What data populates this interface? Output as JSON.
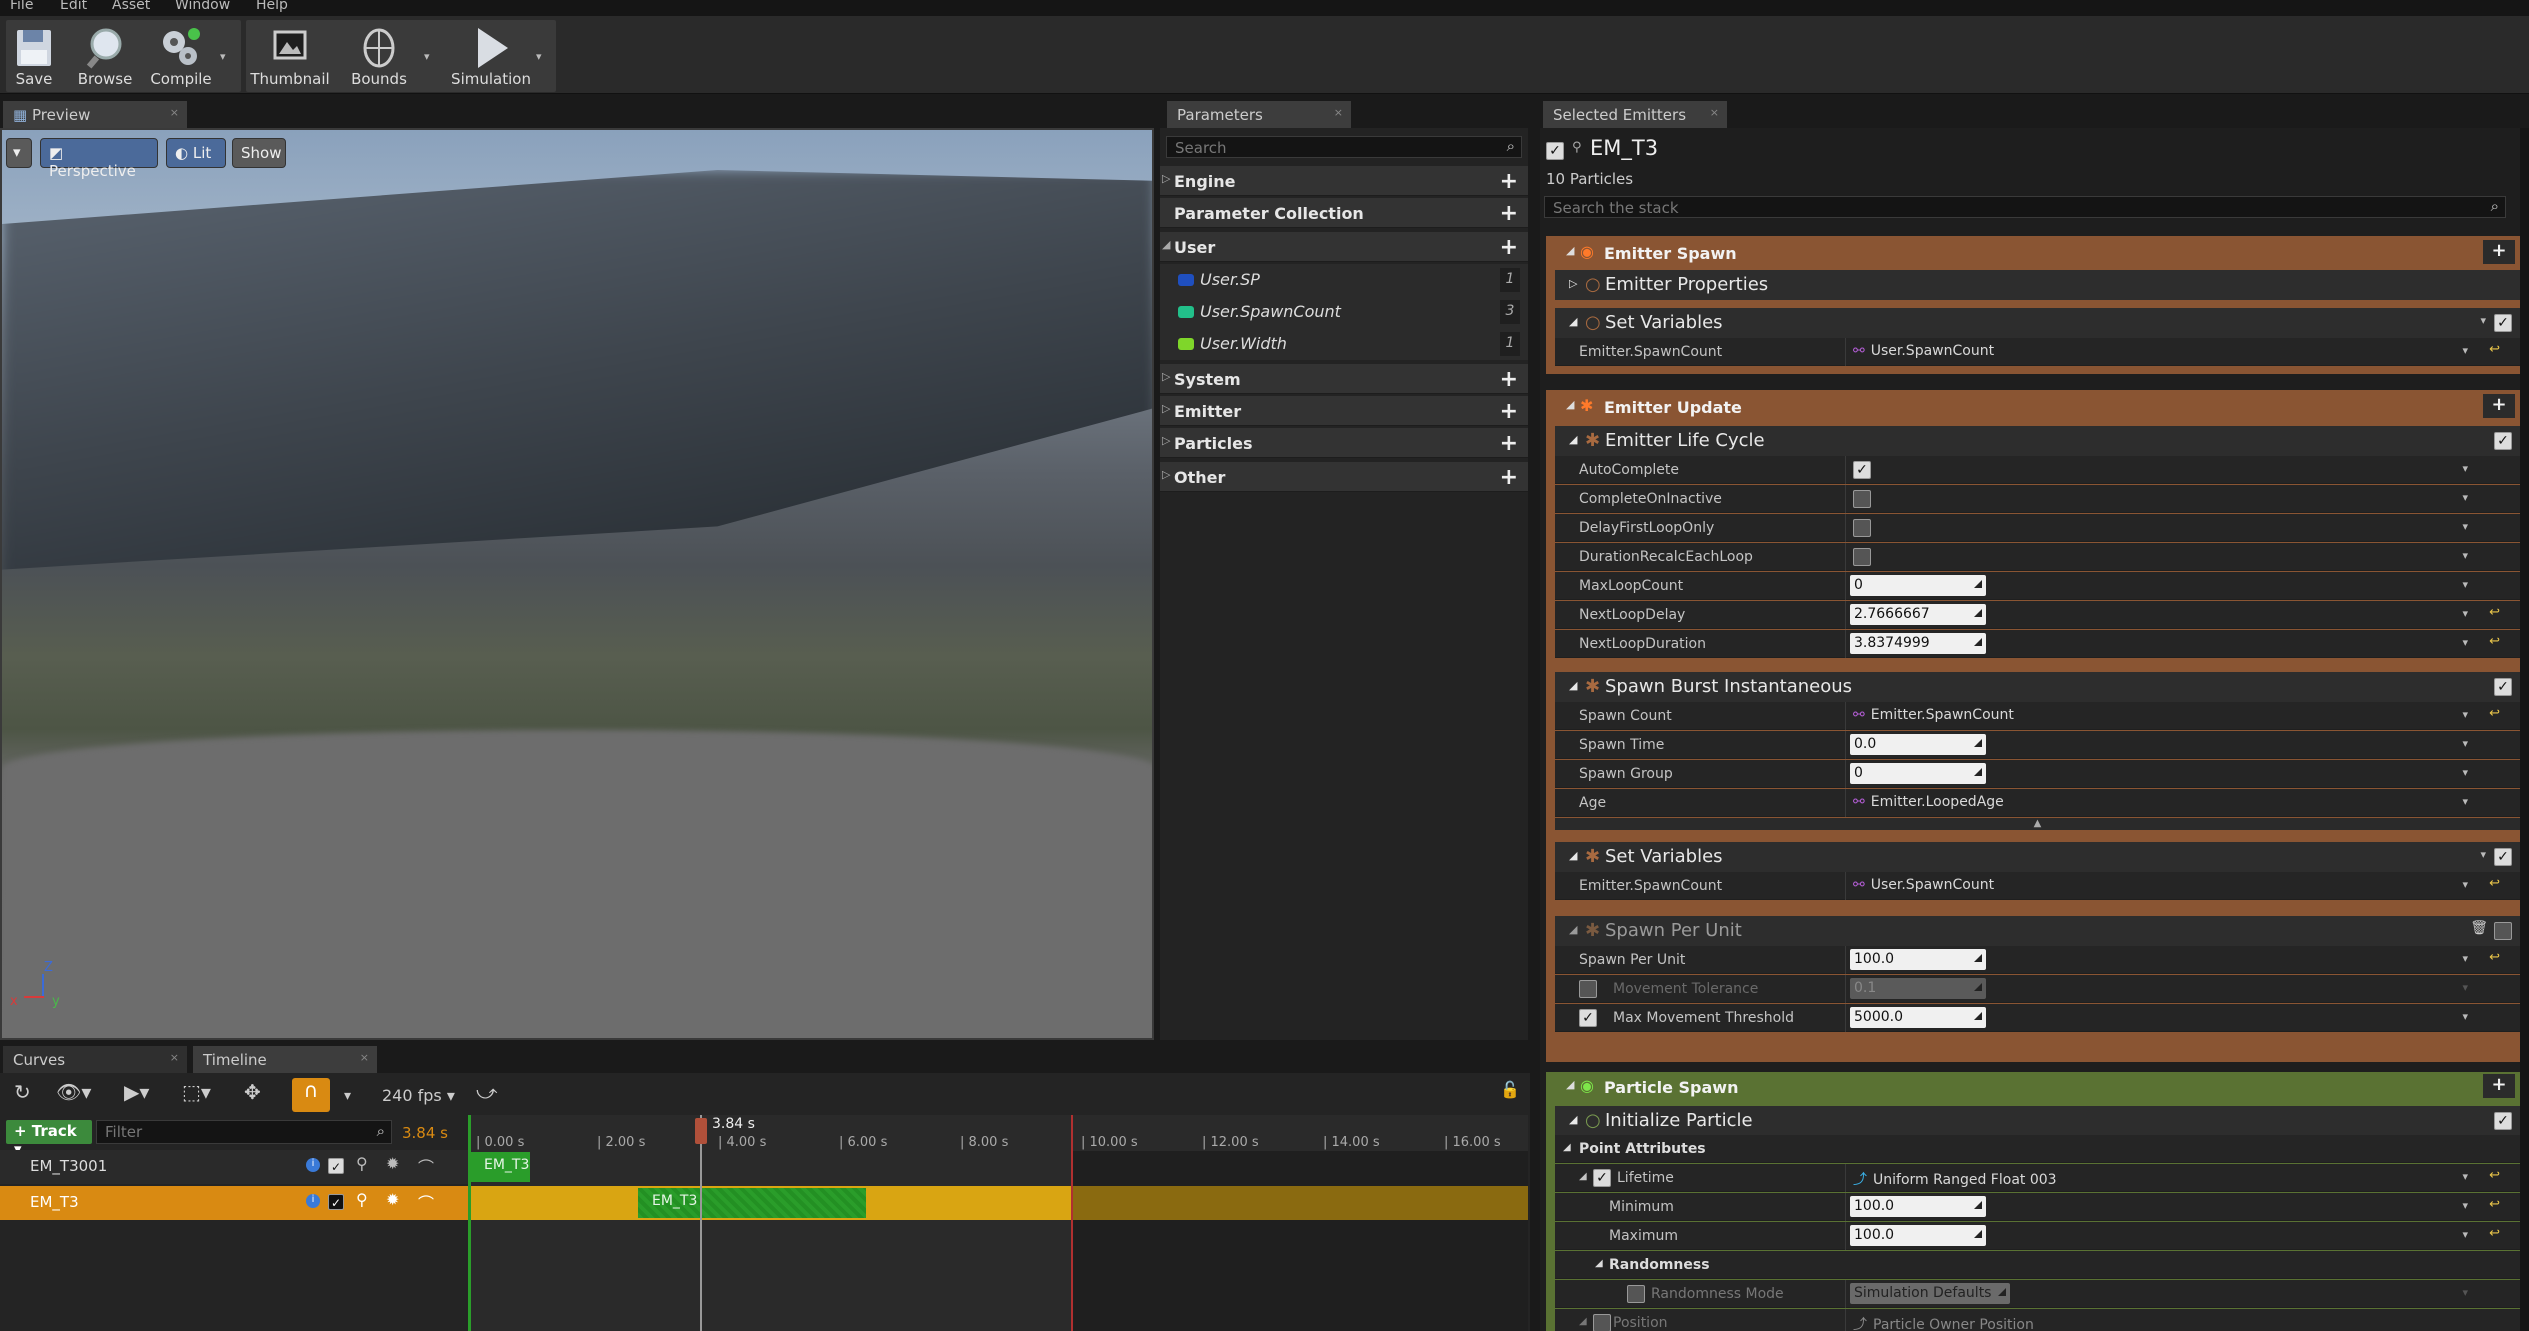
{
  "menu": [
    "File",
    "Edit",
    "Asset",
    "Window",
    "Help"
  ],
  "toolbar": {
    "save": "Save",
    "browse": "Browse",
    "compile": "Compile",
    "thumbnail": "Thumbnail",
    "bounds": "Bounds",
    "simulation": "Simulation"
  },
  "preview": {
    "tab": "Preview",
    "perspective": "Perspective",
    "lit": "Lit",
    "show": "Show"
  },
  "parameters": {
    "tab": "Parameters",
    "search_placeholder": "Search",
    "categories": {
      "engine": "Engine",
      "collection": "Parameter Collection",
      "user": "User",
      "system": "System",
      "emitter": "Emitter",
      "particles": "Particles",
      "other": "Other"
    },
    "user_items": [
      {
        "name": "User.SP",
        "value": "1",
        "color": "#1f4fbf"
      },
      {
        "name": "User.SpawnCount",
        "value": "3",
        "color": "#22c08a"
      },
      {
        "name": "User.Width",
        "value": "1",
        "color": "#7fd62a"
      }
    ]
  },
  "emitters": {
    "tab": "Selected Emitters",
    "name": "EM_T3",
    "particles": "10 Particles",
    "search_placeholder": "Search the stack",
    "emitter_spawn": "Emitter Spawn",
    "emitter_properties": "Emitter Properties",
    "set_variables_1": "Set Variables",
    "ev_spawncount": "Emitter.SpawnCount",
    "user_spawncount": "User.SpawnCount",
    "emitter_update": "Emitter Update",
    "life_cycle": "Emitter Life Cycle",
    "auto_complete": "AutoComplete",
    "complete_on_inactive": "CompleteOnInactive",
    "delay_first": "DelayFirstLoopOnly",
    "duration_recalc": "DurationRecalcEachLoop",
    "max_loop_count": "MaxLoopCount",
    "max_loop_count_val": "0",
    "next_loop_delay": "NextLoopDelay",
    "next_loop_delay_val": "2.7666667",
    "next_loop_duration": "NextLoopDuration",
    "next_loop_duration_val": "3.8374999",
    "spawn_burst": "Spawn Burst Instantaneous",
    "spawn_count": "Spawn Count",
    "spawn_count_link": "Emitter.SpawnCount",
    "spawn_time": "Spawn Time",
    "spawn_time_val": "0.0",
    "spawn_group": "Spawn Group",
    "spawn_group_val": "0",
    "age": "Age",
    "age_link": "Emitter.LoopedAge",
    "set_variables_2": "Set Variables",
    "spawn_per_unit_mod": "Spawn Per Unit",
    "spawn_per_unit": "Spawn Per Unit",
    "spawn_per_unit_val": "100.0",
    "movement_tolerance": "Movement Tolerance",
    "movement_tolerance_val": "0.1",
    "max_movement": "Max Movement Threshold",
    "max_movement_val": "5000.0",
    "particle_spawn": "Particle Spawn",
    "init_particle": "Initialize Particle",
    "point_attributes": "Point Attributes",
    "lifetime": "Lifetime",
    "lifetime_link": "Uniform Ranged Float 003",
    "minimum": "Minimum",
    "minimum_val": "100.0",
    "maximum": "Maximum",
    "maximum_val": "100.0",
    "randomness": "Randomness",
    "randomness_mode": "Randomness Mode",
    "randomness_mode_val": "Simulation Defaults",
    "position": "Position",
    "position_link": "Particle Owner Position"
  },
  "timeline": {
    "curves_tab": "Curves",
    "timeline_tab": "Timeline",
    "fps": "240 fps",
    "track_btn": "Track",
    "filter_placeholder": "Filter",
    "current_time_label": "3.84 s",
    "playhead": "3.84 s",
    "ticks": [
      "0.00 s",
      "2.00 s",
      "4.00 s",
      "6.00 s",
      "8.00 s",
      "10.00 s",
      "12.00 s",
      "14.00 s",
      "16.00 s"
    ],
    "tracks": [
      {
        "name": "EM_T3001",
        "clip": "EM_T3"
      },
      {
        "name": "EM_T3",
        "clip": "EM_T3"
      }
    ]
  },
  "colors": {
    "accent_orange": "#d98a12",
    "spawn_header": "#8a5533",
    "particle_header": "#5a7233",
    "clip_green": "#2a9d2a"
  }
}
